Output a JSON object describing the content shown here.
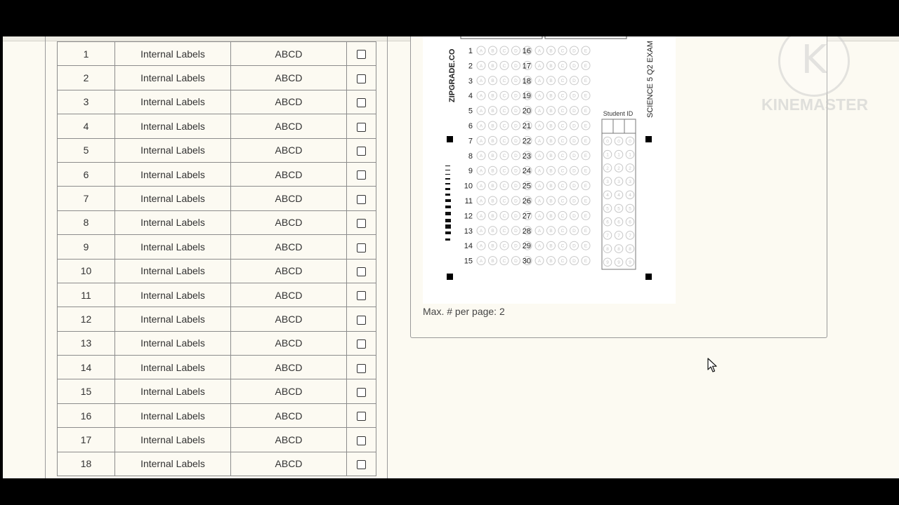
{
  "questions_table": {
    "rows": [
      {
        "num": "1",
        "label": "Internal Labels",
        "answers": "ABCD"
      },
      {
        "num": "2",
        "label": "Internal Labels",
        "answers": "ABCD"
      },
      {
        "num": "3",
        "label": "Internal Labels",
        "answers": "ABCD"
      },
      {
        "num": "4",
        "label": "Internal Labels",
        "answers": "ABCD"
      },
      {
        "num": "5",
        "label": "Internal Labels",
        "answers": "ABCD"
      },
      {
        "num": "6",
        "label": "Internal Labels",
        "answers": "ABCD"
      },
      {
        "num": "7",
        "label": "Internal Labels",
        "answers": "ABCD"
      },
      {
        "num": "8",
        "label": "Internal Labels",
        "answers": "ABCD"
      },
      {
        "num": "9",
        "label": "Internal Labels",
        "answers": "ABCD"
      },
      {
        "num": "10",
        "label": "Internal Labels",
        "answers": "ABCD"
      },
      {
        "num": "11",
        "label": "Internal Labels",
        "answers": "ABCD"
      },
      {
        "num": "12",
        "label": "Internal Labels",
        "answers": "ABCD"
      },
      {
        "num": "13",
        "label": "Internal Labels",
        "answers": "ABCD"
      },
      {
        "num": "14",
        "label": "Internal Labels",
        "answers": "ABCD"
      },
      {
        "num": "15",
        "label": "Internal Labels",
        "answers": "ABCD"
      },
      {
        "num": "16",
        "label": "Internal Labels",
        "answers": "ABCD"
      },
      {
        "num": "17",
        "label": "Internal Labels",
        "answers": "ABCD"
      },
      {
        "num": "18",
        "label": "Internal Labels",
        "answers": "ABCD"
      }
    ]
  },
  "answer_sheet": {
    "brand_text": "ZIPGRADE.CO",
    "exam_title": "SCIENCE 5 Q2 EXAM",
    "student_id_label": "Student ID",
    "left_numbers": [
      "1",
      "2",
      "3",
      "4",
      "5",
      "6",
      "7",
      "8",
      "9",
      "10",
      "11",
      "12",
      "13",
      "14",
      "15"
    ],
    "right_numbers": [
      "16",
      "17",
      "18",
      "19",
      "20",
      "21",
      "22",
      "23",
      "24",
      "25",
      "26",
      "27",
      "28",
      "29",
      "30"
    ],
    "bubble_letters": [
      "A",
      "B",
      "C",
      "D",
      "E"
    ],
    "id_digits": [
      "0",
      "1",
      "2",
      "3",
      "4",
      "5",
      "6",
      "7",
      "8",
      "9"
    ],
    "max_per_page": "Max. # per page: 2"
  },
  "watermark": {
    "logo_letter": "K",
    "text": "KINEMASTER"
  },
  "icons": {
    "checkbox": "checkbox-icon",
    "cursor": "mouse-cursor-icon",
    "watermark_logo": "kinemaster-logo-icon"
  },
  "colors": {
    "page_bg": "#fcfaf2",
    "border": "#8c8c8c",
    "text": "#333333",
    "bubble": "#c8c8c8"
  }
}
